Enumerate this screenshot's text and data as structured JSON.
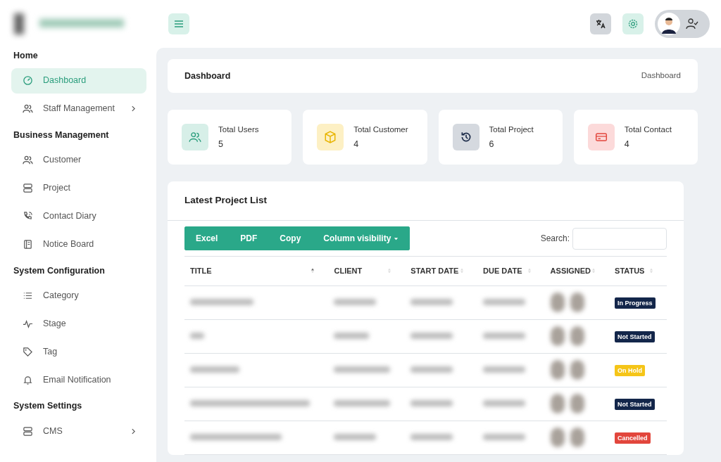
{
  "sidebar": {
    "sections": [
      {
        "title": "Home",
        "items": [
          {
            "label": "Dashboard",
            "selected": true,
            "expandable": false
          },
          {
            "label": "Staff Management",
            "selected": false,
            "expandable": true
          }
        ]
      },
      {
        "title": "Business Management",
        "items": [
          {
            "label": "Customer",
            "selected": false,
            "expandable": false
          },
          {
            "label": "Project",
            "selected": false,
            "expandable": false
          },
          {
            "label": "Contact Diary",
            "selected": false,
            "expandable": false
          },
          {
            "label": "Notice Board",
            "selected": false,
            "expandable": false
          }
        ]
      },
      {
        "title": "System Configuration",
        "items": [
          {
            "label": "Category",
            "selected": false,
            "expandable": false
          },
          {
            "label": "Stage",
            "selected": false,
            "expandable": false
          },
          {
            "label": "Tag",
            "selected": false,
            "expandable": false
          },
          {
            "label": "Email Notification",
            "selected": false,
            "expandable": false
          }
        ]
      },
      {
        "title": "System Settings",
        "items": [
          {
            "label": "CMS",
            "selected": false,
            "expandable": true
          }
        ]
      }
    ]
  },
  "breadcrumb": {
    "title": "Dashboard",
    "trail": "Dashboard"
  },
  "stats": [
    {
      "label": "Total Users",
      "value": "5",
      "color": "#d7efe8"
    },
    {
      "label": "Total Customer",
      "value": "4",
      "color": "#fdf0c4"
    },
    {
      "label": "Total Project",
      "value": "6",
      "color": "#d5d9df"
    },
    {
      "label": "Total Contact",
      "value": "4",
      "color": "#fcdada"
    }
  ],
  "project_list": {
    "title": "Latest Project List",
    "buttons": [
      "Excel",
      "PDF",
      "Copy",
      "Column visibility"
    ],
    "search_label": "Search:",
    "columns": [
      {
        "label": "TITLE",
        "sorted": true
      },
      {
        "label": "CLIENT",
        "sorted": false
      },
      {
        "label": "START DATE",
        "sorted": false
      },
      {
        "label": "DUE DATE",
        "sorted": false
      },
      {
        "label": "ASSIGNED",
        "sorted": false
      },
      {
        "label": "STATUS",
        "sorted": false
      }
    ],
    "rows": [
      {
        "status": "In Progress",
        "color": "#13264a"
      },
      {
        "status": "Not Started",
        "color": "#13264a"
      },
      {
        "status": "On Hold",
        "color": "#f5c518"
      },
      {
        "status": "Not Started",
        "color": "#13264a"
      },
      {
        "status": "Cancelled",
        "color": "#e2463c"
      }
    ]
  }
}
